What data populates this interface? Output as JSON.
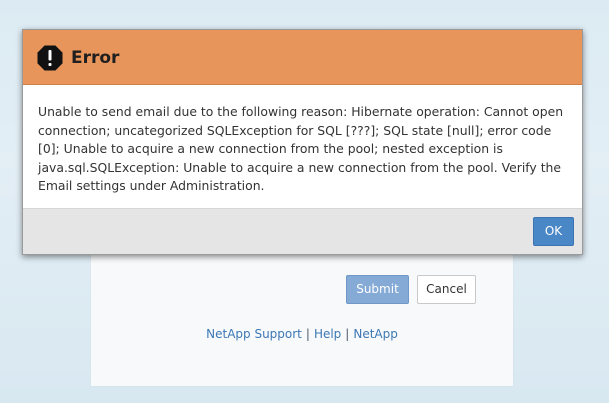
{
  "background_form": {
    "submit_label": "Submit",
    "cancel_label": "Cancel",
    "footer_links": [
      "NetApp Support",
      "Help",
      "NetApp"
    ],
    "footer_separator": "|"
  },
  "dialog": {
    "icon": "exclamation-octagon-icon",
    "title": "Error",
    "message": "Unable to send email due to the following reason: Hibernate operation: Cannot open connection; uncategorized SQLException for SQL [???]; SQL state [null]; error code [0]; Unable to acquire a new connection from the pool; nested exception is java.sql.SQLException: Unable to acquire a new connection from the pool. Verify the Email settings under Administration.",
    "ok_label": "OK"
  },
  "colors": {
    "header": "#e8955b",
    "ok_button": "#4a87c7",
    "submit_button": "#86aad6"
  }
}
